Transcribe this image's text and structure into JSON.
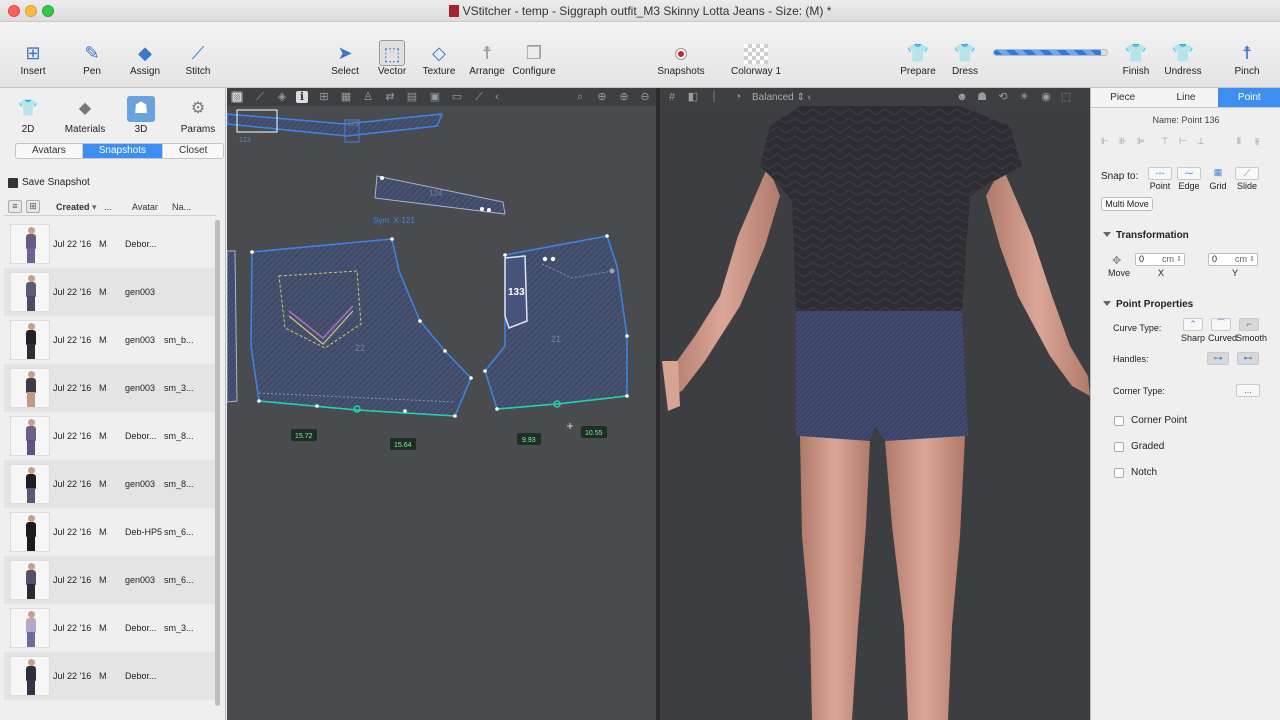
{
  "window": {
    "title": "VStitcher - temp - Siggraph outfit_M3 Skinny Lotta Jeans - Size: (M) *"
  },
  "toolbar": {
    "insert": "Insert",
    "pen": "Pen",
    "assign": "Assign",
    "stitch": "Stitch",
    "select": "Select",
    "vector": "Vector",
    "texture": "Texture",
    "arrange": "Arrange",
    "configure": "Configure",
    "snapshots": "Snapshots",
    "colorway": "Colorway 1",
    "prepare": "Prepare",
    "dress": "Dress",
    "finish": "Finish",
    "undress": "Undress",
    "pinch": "Pinch",
    "simulation_progress": 0.95
  },
  "left_panel": {
    "modes": {
      "m2d": "2D",
      "materials": "Materials",
      "m3d": "3D",
      "params": "Params"
    },
    "tabs": {
      "avatars": "Avatars",
      "snapshots": "Snapshots",
      "closet": "Closet"
    },
    "save_snapshot": "Save Snapshot",
    "columns": {
      "created": "Created",
      "more": "...",
      "avatar": "Avatar",
      "name": "Na..."
    },
    "rows": [
      {
        "date": "Jul 22 '16",
        "size": "M",
        "avatar": "Debor...",
        "name": "",
        "top": "#6b5a86",
        "legs": "#6e6490"
      },
      {
        "date": "Jul 22 '16",
        "size": "M",
        "avatar": "gen003",
        "name": "",
        "top": "#5c5a7a",
        "legs": "#4c4a66"
      },
      {
        "date": "Jul 22 '16",
        "size": "M",
        "avatar": "gen003",
        "name": "sm_b...",
        "top": "#222226",
        "legs": "#2c2c34"
      },
      {
        "date": "Jul 22 '16",
        "size": "M",
        "avatar": "gen003",
        "name": "sm_3...",
        "top": "#3d3a44",
        "legs": "#c29a82"
      },
      {
        "date": "Jul 22 '16",
        "size": "M",
        "avatar": "Debor...",
        "name": "sm_8...",
        "top": "#6e5d8d",
        "legs": "#5e5380"
      },
      {
        "date": "Jul 22 '16",
        "size": "M",
        "avatar": "gen003",
        "name": "sm_8...",
        "top": "#1e1e22",
        "legs": "#5b5677"
      },
      {
        "date": "Jul 22 '16",
        "size": "M",
        "avatar": "Deb-HP5",
        "name": "sm_6...",
        "top": "#1b1b1f",
        "legs": "#1b1b1f"
      },
      {
        "date": "Jul 22 '16",
        "size": "M",
        "avatar": "gen003",
        "name": "sm_6...",
        "top": "#55506e",
        "legs": "#2a2a30"
      },
      {
        "date": "Jul 22 '16",
        "size": "M",
        "avatar": "Debor...",
        "name": "sm_3...",
        "top": "#b8a6c8",
        "legs": "#6f6aa0"
      },
      {
        "date": "Jul 22 '16",
        "size": "M",
        "avatar": "Debor...",
        "name": "",
        "top": "#2c2e3a",
        "legs": "#323446"
      }
    ]
  },
  "pattern_view": {
    "labels": {
      "piece_a": "124",
      "piece_b": "22",
      "piece_c": "21",
      "pocket": "133",
      "top_strip": "123",
      "top_strip_b": "125",
      "sym": "Sym: X-121"
    },
    "measurements": {
      "m1": "15.72",
      "m2": "15.64",
      "m3": "9.93",
      "m4": "10.55"
    }
  },
  "view3d": {
    "mode": "Balanced"
  },
  "right_panel": {
    "tabs": {
      "piece": "Piece",
      "line": "Line",
      "point": "Point"
    },
    "name_label": "Name: Point 136",
    "snap_to": "Snap to:",
    "snap": {
      "point": "Point",
      "edge": "Edge",
      "grid": "Grid",
      "slide": "Slide"
    },
    "multi_move": "Multi Move",
    "transformation": "Transformation",
    "move": "Move",
    "x_value": "0",
    "y_value": "0",
    "unit": "cm",
    "x_label": "X",
    "y_label": "Y",
    "point_properties": "Point Properties",
    "curve_type": "Curve Type:",
    "curve": {
      "sharp": "Sharp",
      "curved": "Curved",
      "smooth": "Smooth"
    },
    "handles": "Handles:",
    "corner_type": "Corner Type:",
    "corner_select": "...",
    "corner_point": "Corner Point",
    "graded": "Graded",
    "notch": "Notch"
  }
}
